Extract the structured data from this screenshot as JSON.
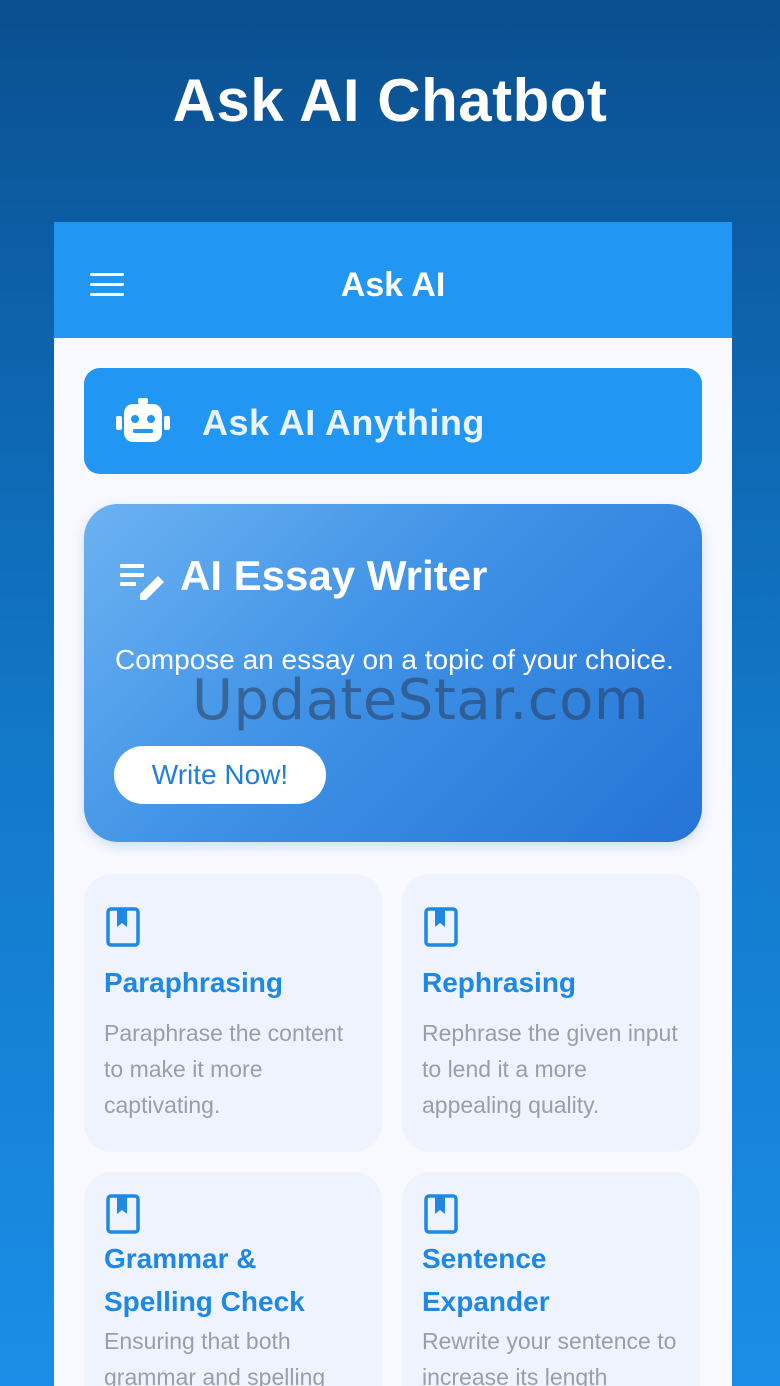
{
  "promo": {
    "title": "Ask AI Chatbot"
  },
  "appbar": {
    "title": "Ask AI",
    "menu_icon": "hamburger-menu-icon"
  },
  "ask_button": {
    "label": "Ask AI Anything",
    "icon": "robot-icon"
  },
  "essay_card": {
    "title": "AI Essay Writer",
    "icon": "edit-notes-icon",
    "description": "Compose an essay on a topic of your choice.",
    "button_label": "Write Now!"
  },
  "watermark": "UpdateStar.com",
  "tools": [
    {
      "title": "Paraphrasing",
      "description": "Paraphrase the content to make it more captivating.",
      "icon": "book-bookmark-icon"
    },
    {
      "title": "Rephrasing",
      "description": "Rephrase the given input to lend it a more appealing quality.",
      "icon": "book-bookmark-icon"
    },
    {
      "title": "Grammar & Spelling Check",
      "description": "Ensuring that both grammar and spelling",
      "icon": "book-bookmark-icon"
    },
    {
      "title": "Sentence Expander",
      "description": "Rewrite your sentence to increase its length",
      "icon": "book-bookmark-icon"
    }
  ],
  "colors": {
    "primary": "#2196f3",
    "accent_text": "#1e88e5",
    "card_bg": "#eef3fd",
    "muted_text": "#999ea8"
  }
}
